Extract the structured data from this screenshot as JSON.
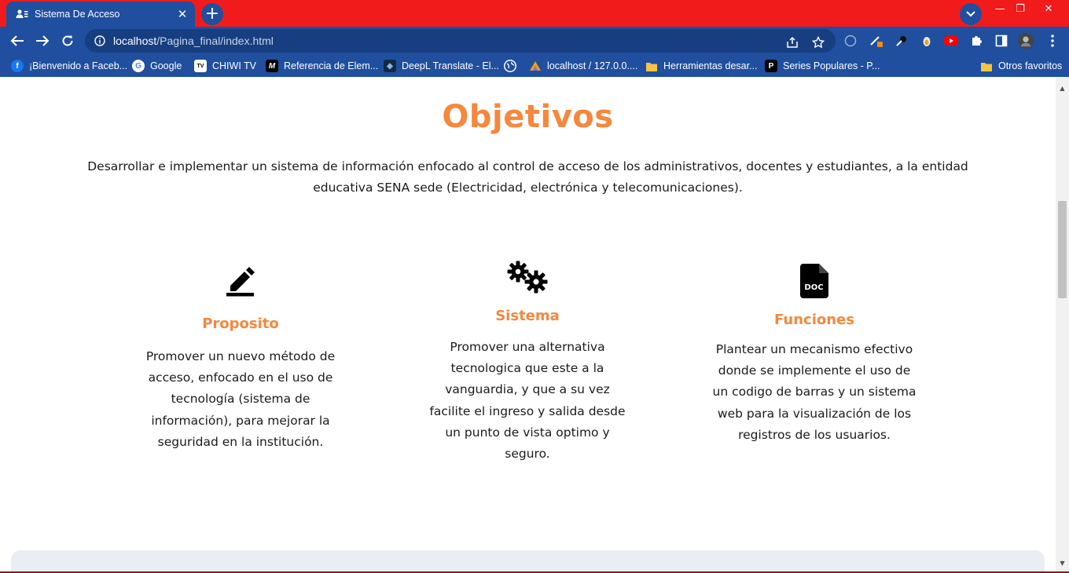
{
  "browser": {
    "tab_title": "Sistema De Acceso",
    "tab_close": "✕",
    "new_tab": "+",
    "url_host": "localhost",
    "url_path": "/Pagina_final/index.html",
    "window_controls": {
      "minimize": "—",
      "restore": "❐",
      "close": "✕"
    }
  },
  "bookmarks": [
    {
      "label": "¡Bienvenido a Faceb...",
      "icon": "facebook-icon",
      "color": "#1877f2",
      "glyph": "f"
    },
    {
      "label": "Google",
      "icon": "google-icon",
      "color": "#ffffff",
      "glyph": "G"
    },
    {
      "label": "CHIWI TV",
      "icon": "tv-icon",
      "color": "#ffffff",
      "glyph": "TV"
    },
    {
      "label": "Referencia de Elem...",
      "icon": "mdn-icon",
      "color": "#000000",
      "glyph": "M"
    },
    {
      "label": "DeepL Translate - El...",
      "icon": "deepl-icon",
      "color": "#0f2b46",
      "glyph": "◆"
    },
    {
      "label": "",
      "icon": "globe-icon",
      "color": "#ffffff",
      "glyph": "🌐"
    },
    {
      "label": "localhost / 127.0.0....",
      "icon": "phpmyadmin-icon",
      "color": "#f39c12",
      "glyph": "▲"
    },
    {
      "label": "Herramientas desar...",
      "icon": "folder-icon",
      "color": "#f6c342",
      "glyph": ""
    },
    {
      "label": "Series Populares - P...",
      "icon": "p-icon",
      "color": "#000000",
      "glyph": "P"
    }
  ],
  "other_bookmarks": "Otros favoritos",
  "page": {
    "title": "Objetivos",
    "description": "Desarrollar e implementar un sistema de información enfocado al control de acceso de los administrativos, docentes y estudiantes, a la entidad educativa SENA sede (Electricidad, electrónica y telecomunicaciones).",
    "columns": [
      {
        "title": "Proposito",
        "icon": "edit-pen-icon",
        "text": "Promover un nuevo método de acceso, enfocado en el uso de tecnología (sistema de información), para mejorar la seguridad en la institución."
      },
      {
        "title": "Sistema",
        "icon": "gears-icon",
        "text": "Promover una alternativa tecnologica que este a la vanguardia, y que a su vez facilite el ingreso y salida desde un punto de vista optimo y seguro."
      },
      {
        "title": "Funciones",
        "icon": "doc-file-icon",
        "icon_label": "DOC",
        "text": "Plantear un mecanismo efectivo donde se implemente el uso de un codigo de barras y un sistema web para la visualización de los registros de los usuarios."
      }
    ]
  },
  "colors": {
    "accent": "#f5883e",
    "tab_strip": "#f21b1b",
    "chrome": "#1f4f9e"
  }
}
